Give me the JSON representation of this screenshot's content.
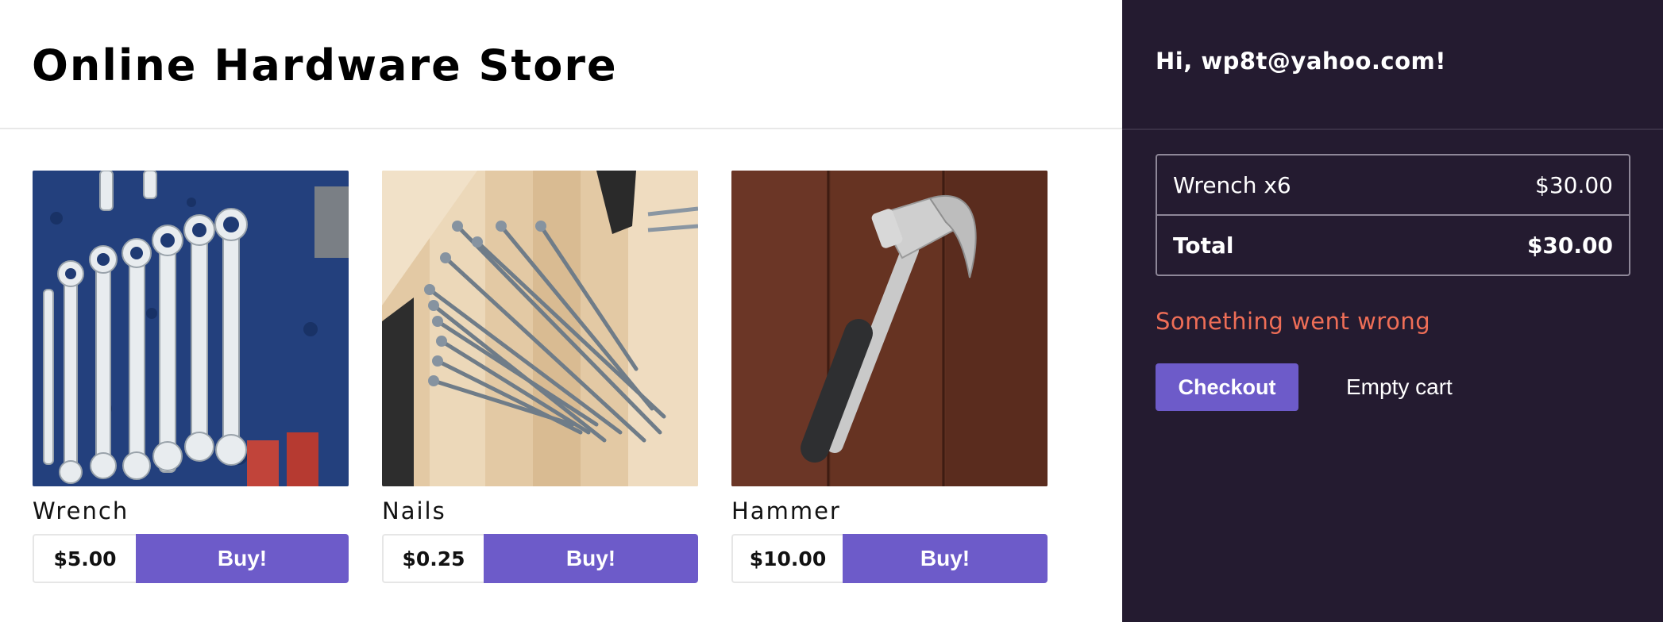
{
  "header": {
    "title": "Online Hardware Store"
  },
  "products": [
    {
      "name": "Wrench",
      "price": "$5.00",
      "buy_label": "Buy!",
      "image": "wrench-photo"
    },
    {
      "name": "Nails",
      "price": "$0.25",
      "buy_label": "Buy!",
      "image": "nails-photo"
    },
    {
      "name": "Hammer",
      "price": "$10.00",
      "buy_label": "Buy!",
      "image": "hammer-photo"
    }
  ],
  "cart": {
    "greeting": "Hi, wp8t@yahoo.com!",
    "items": [
      {
        "label": "Wrench x6",
        "amount": "$30.00"
      }
    ],
    "total_label": "Total",
    "total_amount": "$30.00",
    "error": "Something went wrong",
    "checkout_label": "Checkout",
    "empty_label": "Empty cart"
  },
  "colors": {
    "accent": "#6d5bc9",
    "sidebar_bg": "#241b30",
    "error": "#ef6e57"
  }
}
